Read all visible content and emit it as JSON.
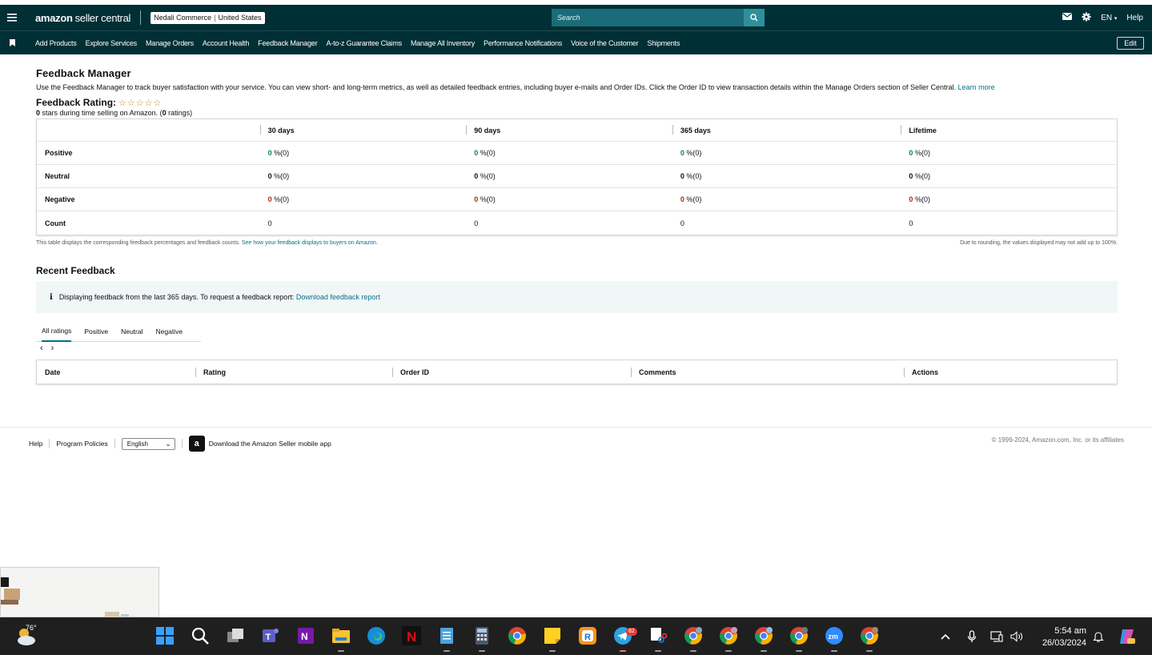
{
  "header": {
    "logo_amazon": "amazon",
    "logo_suffix": "seller central",
    "store_name": "Nedali Commerce",
    "store_region": "United States",
    "search_placeholder": "Search",
    "language": "EN",
    "help": "Help"
  },
  "nav": {
    "items": [
      "Add Products",
      "Explore Services",
      "Manage Orders",
      "Account Health",
      "Feedback Manager",
      "A-to-z Guarantee Claims",
      "Manage All Inventory",
      "Performance Notifications",
      "Voice of the Customer",
      "Shipments"
    ],
    "edit": "Edit"
  },
  "page": {
    "title": "Feedback Manager",
    "intro": "Use the Feedback Manager to track buyer satisfaction with your service. You can view short- and long-term metrics, as well as detailed feedback entries, including buyer e-mails and Order IDs. Click the Order ID to view transaction details within the Manage Orders section of Seller Central.",
    "learn_more": "Learn more",
    "rating_label": "Feedback Rating:",
    "rating_stars": 0,
    "rating_count": "0",
    "rating_sub_mid": "stars during time selling on Amazon. (",
    "rating_count_ratings": "0",
    "rating_sub_end": "ratings)"
  },
  "metrics": {
    "columns": [
      "30 days",
      "90 days",
      "365 days",
      "Lifetime"
    ],
    "rows": [
      {
        "label": "Positive",
        "values": [
          "0",
          "0",
          "0",
          "0"
        ],
        "suffix": "%(0)"
      },
      {
        "label": "Neutral",
        "values": [
          "0",
          "0",
          "0",
          "0"
        ],
        "suffix": "%(0)"
      },
      {
        "label": "Negative",
        "values": [
          "0",
          "0",
          "0",
          "0"
        ],
        "suffix": "%(0)"
      },
      {
        "label": "Count",
        "values": [
          "0",
          "0",
          "0",
          "0"
        ],
        "suffix": ""
      }
    ],
    "note_left": "This table displays the corresponding feedback percentages and feedback counts.",
    "note_link": "See how your feedback displays to buyers on Amazon.",
    "note_right": "Due to rounding, the values displayed may not add up to 100%."
  },
  "recent": {
    "title": "Recent Feedback",
    "info_text": "Displaying feedback from the last 365 days. To request a feedback report:",
    "info_link": "Download feedback report",
    "tabs": [
      "All ratings",
      "Positive",
      "Neutral",
      "Negative"
    ],
    "columns": [
      "Date",
      "Rating",
      "Order ID",
      "Comments",
      "Actions"
    ]
  },
  "footer": {
    "help": "Help",
    "policies": "Program Policies",
    "language": "English",
    "app": "Download the Amazon Seller mobile app",
    "copyright": "© 1999-2024, Amazon.com, Inc. or its affiliates"
  },
  "taskbar": {
    "temperature": "76°",
    "telegram_badge": "82",
    "time": "5:54 am",
    "date": "26/03/2024"
  },
  "colors": {
    "header_bg": "#002f36",
    "link": "#00728a",
    "positive": "#067d62",
    "negative": "#b12704"
  }
}
